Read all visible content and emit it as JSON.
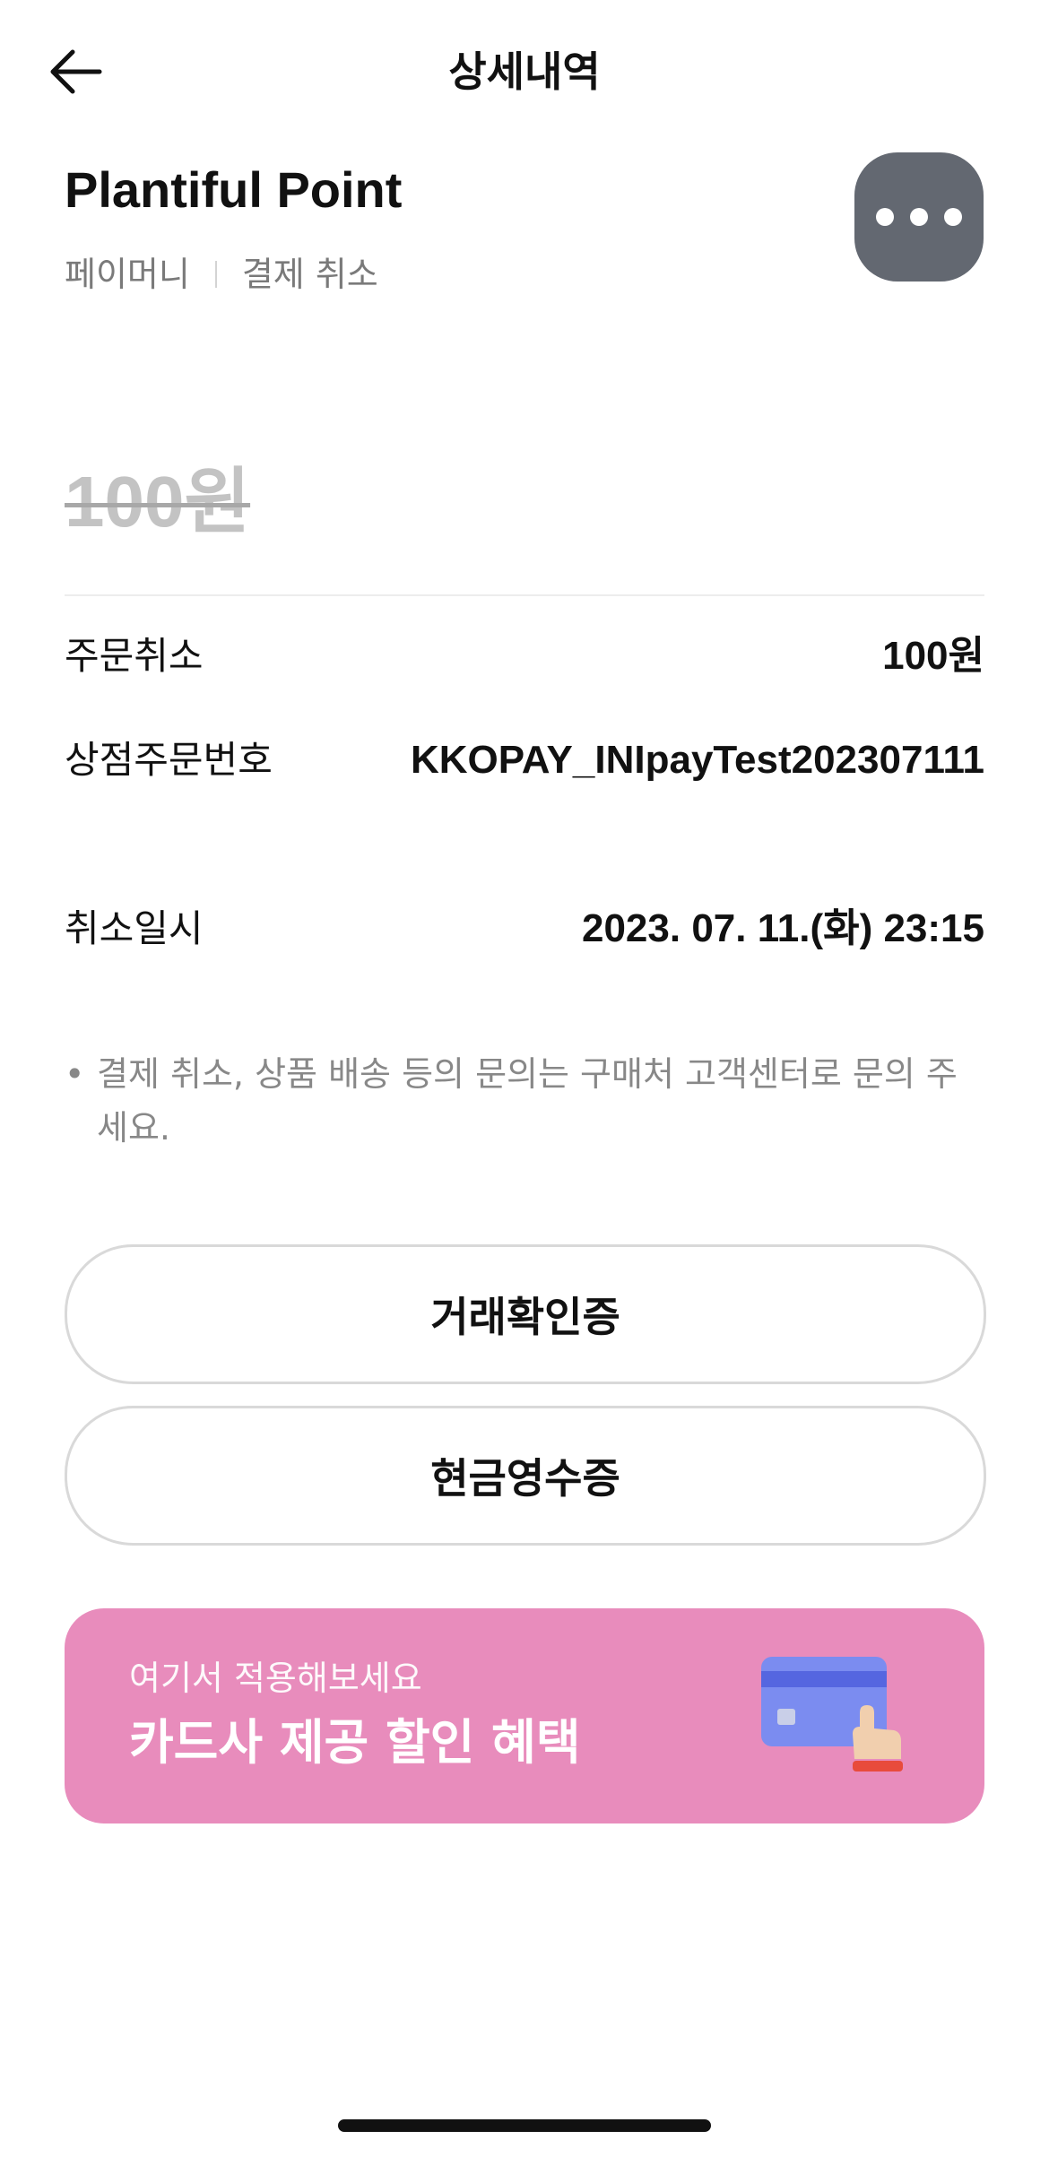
{
  "header": {
    "title": "상세내역",
    "back_icon": "arrow-left-icon"
  },
  "merchant": {
    "name": "Plantiful Point",
    "payment_method": "페이머니",
    "status": "결제 취소",
    "more_icon": "more-horizontal-icon"
  },
  "amount": {
    "value": "100원",
    "strikethrough": true
  },
  "details": [
    {
      "label": "주문취소",
      "value": "100원"
    },
    {
      "label": "상점주문번호",
      "value": "KKOPAY_INIpayTest202307111"
    },
    {
      "label": "취소일시",
      "value": "2023. 07. 11.(화) 23:15"
    }
  ],
  "notice": {
    "bullet": "•",
    "text": "결제 취소, 상품 배송 등의 문의는 구매처 고객센터로 문의 주세요."
  },
  "buttons": {
    "transaction_certificate": "거래확인증",
    "cash_receipt": "현금영수증"
  },
  "promo": {
    "subtitle": "여기서 적용해보세요",
    "title": "카드사 제공 할인 혜택",
    "icon": "card-tap-icon",
    "background_color": "#e88cbc"
  },
  "colors": {
    "more_button": "#636871",
    "amount_struck": "#c3c3c3",
    "muted_text": "#7a7a7a"
  }
}
